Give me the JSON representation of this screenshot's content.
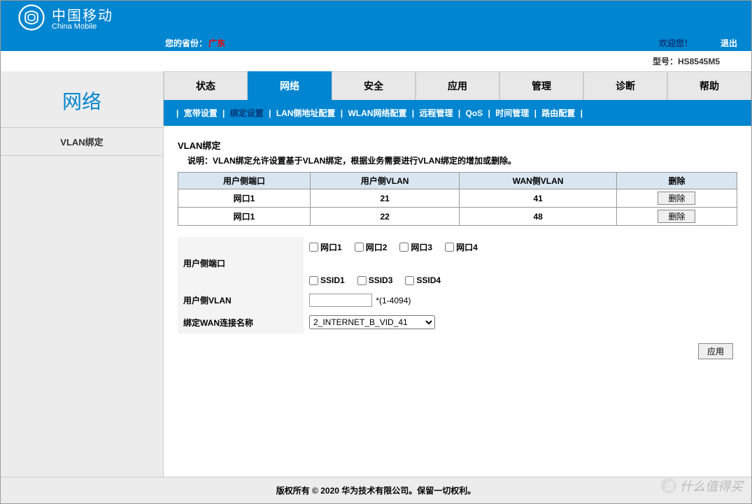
{
  "brand": {
    "cn": "中国移动",
    "en": "China Mobile"
  },
  "header": {
    "province_label": "您的省份：",
    "province_value": "广东",
    "welcome": "欢迎您！",
    "logout": "退出"
  },
  "model": {
    "label": "型号：",
    "value": "HS8545M5"
  },
  "sidebar": {
    "title": "网络",
    "items": [
      "VLAN绑定"
    ]
  },
  "tabs": [
    {
      "label": "状态",
      "active": false
    },
    {
      "label": "网络",
      "active": true
    },
    {
      "label": "安全",
      "active": false
    },
    {
      "label": "应用",
      "active": false
    },
    {
      "label": "管理",
      "active": false
    },
    {
      "label": "诊断",
      "active": false
    },
    {
      "label": "帮助",
      "active": false
    }
  ],
  "subtabs": [
    {
      "label": "宽带设置",
      "active": false
    },
    {
      "label": "绑定设置",
      "active": true
    },
    {
      "label": "LAN侧地址配置",
      "active": false
    },
    {
      "label": "WLAN网络配置",
      "active": false
    },
    {
      "label": "远程管理",
      "active": false
    },
    {
      "label": "QoS",
      "active": false
    },
    {
      "label": "时间管理",
      "active": false
    },
    {
      "label": "路由配置",
      "active": false
    }
  ],
  "section": {
    "title": "VLAN绑定",
    "desc": "说明：VLAN绑定允许设置基于VLAN绑定，根据业务需要进行VLAN绑定的增加或删除。"
  },
  "table": {
    "headers": [
      "用户侧端口",
      "用户侧VLAN",
      "WAN侧VLAN",
      "删除"
    ],
    "delete_label": "删除",
    "rows": [
      {
        "port": "网口1",
        "user_vlan": "21",
        "wan_vlan": "41"
      },
      {
        "port": "网口1",
        "user_vlan": "22",
        "wan_vlan": "48"
      }
    ]
  },
  "form": {
    "port_label": "用户侧端口",
    "port_options": [
      "网口1",
      "网口2",
      "网口3",
      "网口4"
    ],
    "ssid_options": [
      "SSID1",
      "SSID3",
      "SSID4"
    ],
    "user_vlan_label": "用户侧VLAN",
    "user_vlan_hint": "*(1-4094)",
    "wan_label": "绑定WAN连接名称",
    "wan_selected": "2_INTERNET_B_VID_41",
    "apply": "应用"
  },
  "footer": "版权所有 © 2020 华为技术有限公司。保留一切权利。",
  "watermark": "什么值得买"
}
